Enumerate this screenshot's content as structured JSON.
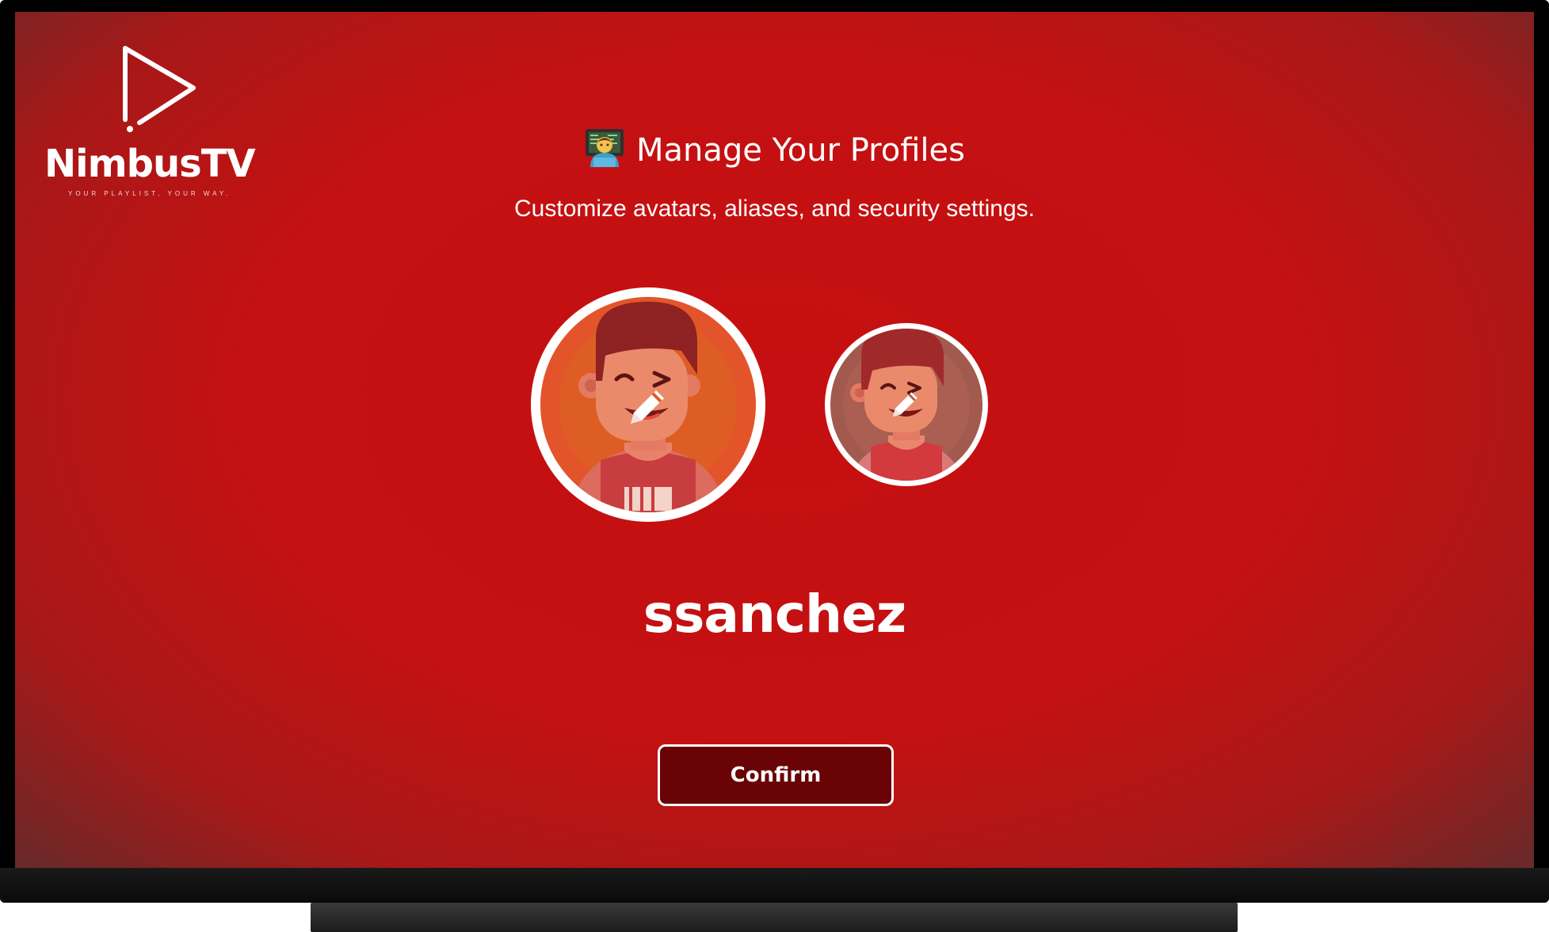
{
  "app": {
    "brand_name": "NimbusTV",
    "tagline": "YOUR PLAYLIST, YOUR WAY.",
    "logo_icon": "play-triangle-icon"
  },
  "header": {
    "title_emoji": "technologist-emoji",
    "title": "Manage Your Profiles",
    "subtitle": "Customize avatars, aliases, and security settings."
  },
  "profiles": [
    {
      "selected": true,
      "edit_icon": "pencil-icon"
    },
    {
      "selected": false,
      "edit_icon": "pencil-icon"
    }
  ],
  "current_profile": {
    "username": "ssanchez"
  },
  "actions": {
    "confirm_label": "Confirm"
  },
  "colors": {
    "background_center": "#c60f10",
    "background_edge": "#484848",
    "button_fill": "#6a0305",
    "text": "#ffffff",
    "avatar_orange": "#e4542a"
  }
}
